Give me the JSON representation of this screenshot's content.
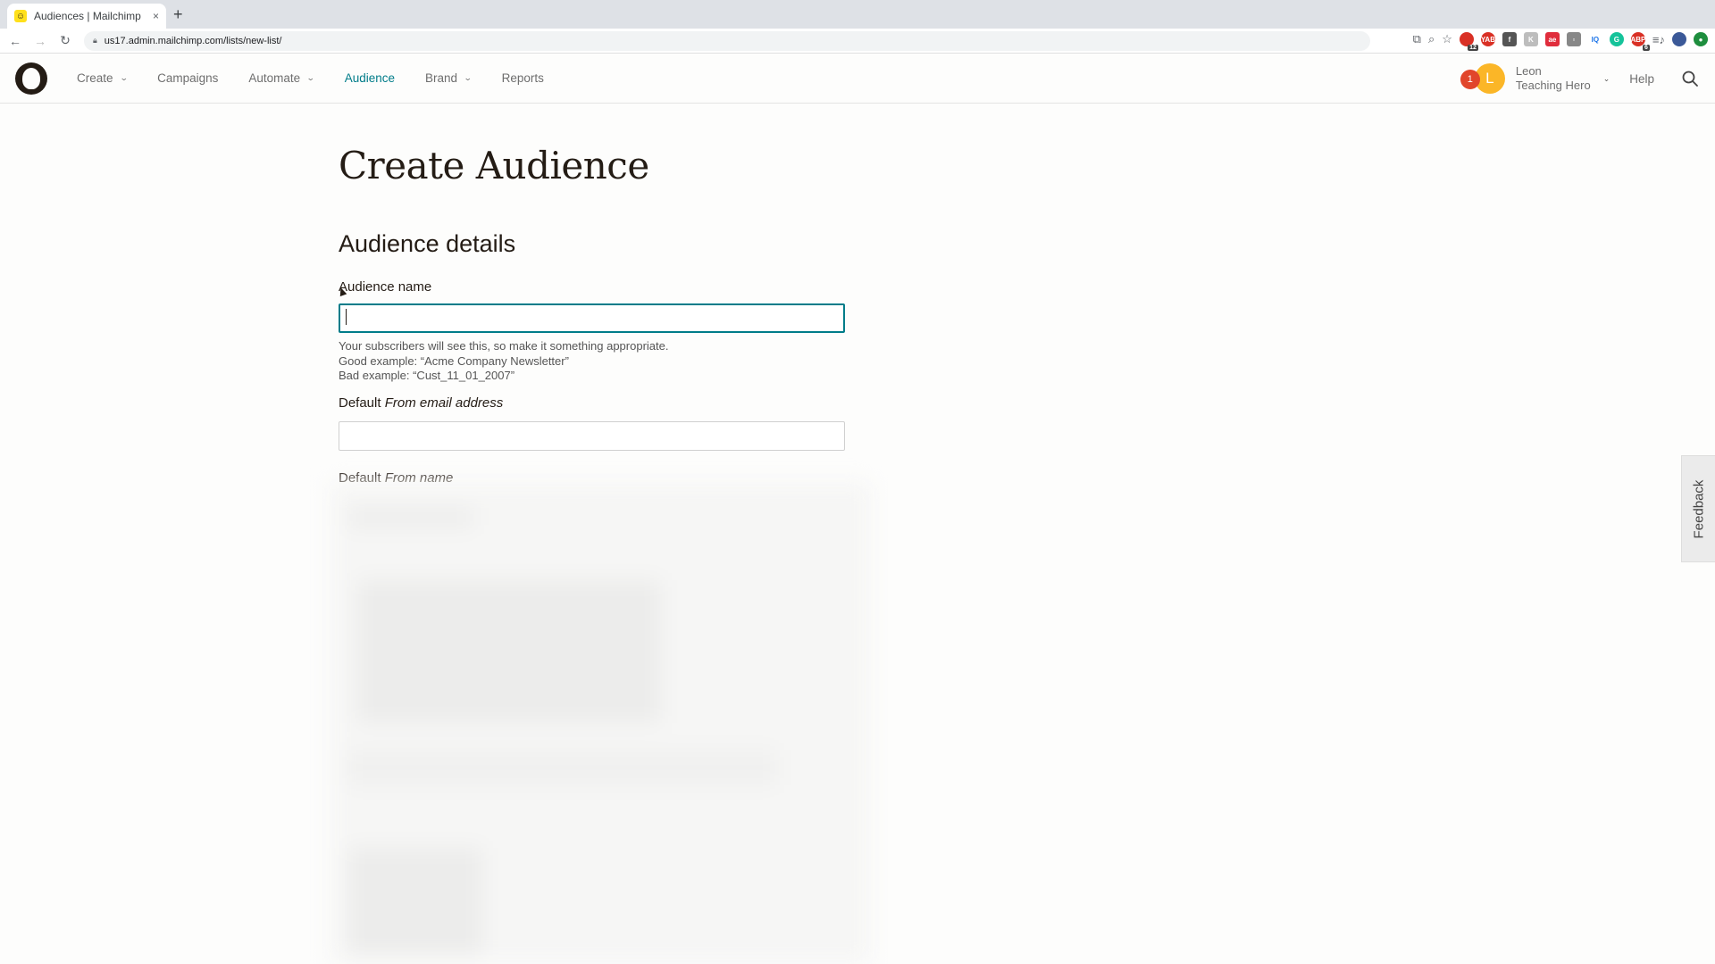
{
  "browser": {
    "tab_title": "Audiences | Mailchimp",
    "tab_close": "×",
    "new_tab": "+",
    "url": "us17.admin.mailchimp.com/lists/new-list/",
    "back": "←",
    "forward": "→",
    "reload": "↻",
    "extensions": [
      {
        "name": "translate-icon",
        "glyph": "⧉"
      },
      {
        "name": "zoom-icon",
        "glyph": "⌕"
      },
      {
        "name": "bookmark-star-icon",
        "glyph": "☆"
      },
      {
        "name": "extension-red-icon",
        "color": "#d93025",
        "badge": "12"
      },
      {
        "name": "extension-yab-icon",
        "color": "#d93025",
        "label": "YAB"
      },
      {
        "name": "facebook-icon",
        "color": "#555555",
        "label": "f"
      },
      {
        "name": "extension-k-icon",
        "color": "#bdbdbd",
        "label": "K"
      },
      {
        "name": "extension-ae-icon",
        "color": "#e02d3c",
        "label": "ae"
      },
      {
        "name": "extension-box-icon",
        "color": "#888888",
        "label": "▫"
      },
      {
        "name": "extension-iq-icon",
        "color": "#ffffff",
        "label": "IQ"
      },
      {
        "name": "grammarly-icon",
        "color": "#15c39a",
        "label": "G"
      },
      {
        "name": "adblock-icon",
        "color": "#d93025",
        "label": "ABP",
        "badge": "6"
      },
      {
        "name": "media-controls-icon",
        "glyph": "≡♪"
      },
      {
        "name": "profile-icon",
        "color": "#3b5998",
        "label": ""
      },
      {
        "name": "extension-green-icon",
        "color": "#1e8e3e",
        "label": "●"
      }
    ]
  },
  "header": {
    "nav": [
      {
        "label": "Create",
        "dropdown": true,
        "active": false
      },
      {
        "label": "Campaigns",
        "dropdown": false,
        "active": false
      },
      {
        "label": "Automate",
        "dropdown": true,
        "active": false
      },
      {
        "label": "Audience",
        "dropdown": false,
        "active": true
      },
      {
        "label": "Brand",
        "dropdown": true,
        "active": false
      },
      {
        "label": "Reports",
        "dropdown": false,
        "active": false
      }
    ],
    "notification_count": "1",
    "avatar_initial": "L",
    "user_name": "Leon",
    "account_name": "Teaching Hero",
    "help_label": "Help",
    "colors": {
      "accent": "#007c89",
      "notification": "#e1462b",
      "avatar": "#fbb627"
    }
  },
  "main": {
    "page_title": "Create Audience",
    "section_title": "Audience details",
    "fields": {
      "audience_name": {
        "label": "Audience name",
        "value": "",
        "help": [
          "Your subscribers will see this, so make it something appropriate.",
          "Good example: “Acme Company Newsletter”",
          "Bad example: “Cust_11_01_2007”"
        ]
      },
      "from_email": {
        "label_prefix": "Default",
        "label_italic": "From email address",
        "value": ""
      },
      "from_name": {
        "label_prefix": "Default",
        "label_italic": "From name"
      }
    }
  },
  "feedback_label": "Feedback"
}
